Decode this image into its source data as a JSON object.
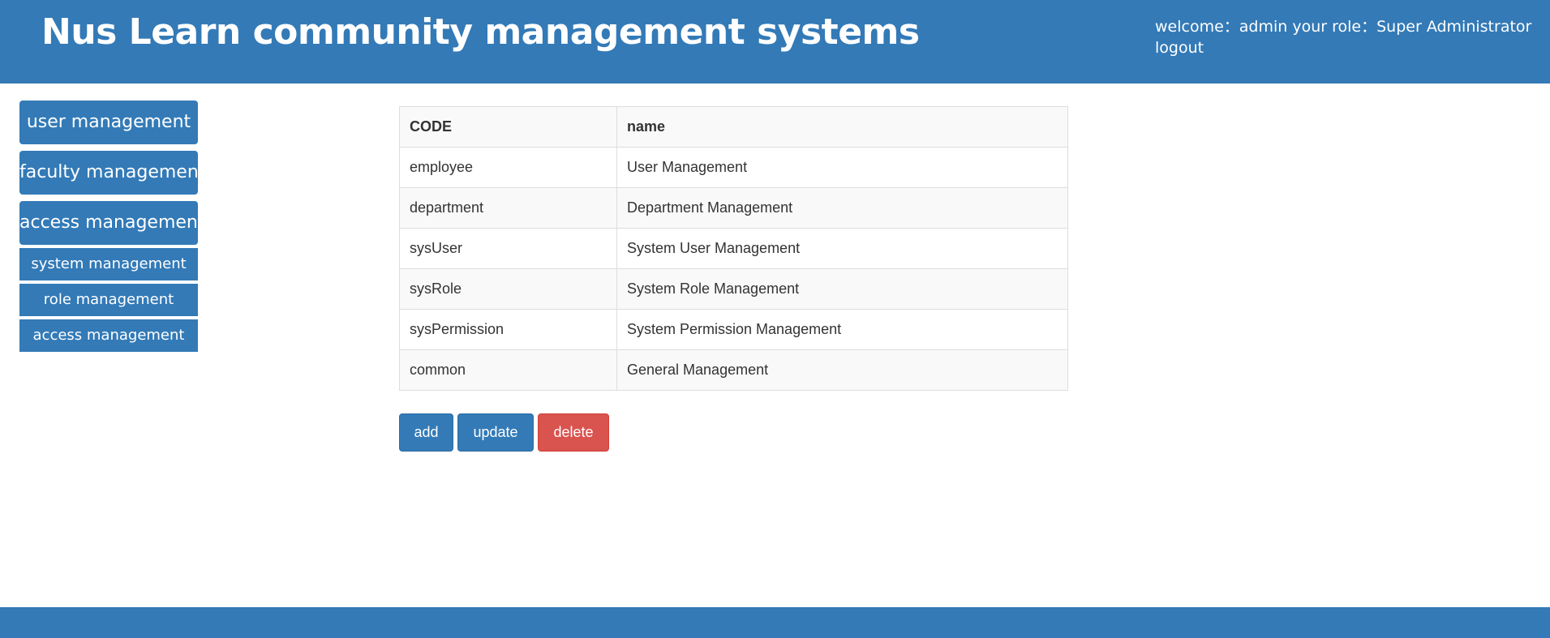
{
  "header": {
    "title": "Nus Learn community management systems",
    "welcome_label": "welcome：",
    "username": "admin",
    "role_label": "your role：",
    "role": "Super Administrator",
    "logout": "logout"
  },
  "sidebar": {
    "items": [
      {
        "label": "user management"
      },
      {
        "label": "faculty management"
      },
      {
        "label": "access management"
      }
    ],
    "subitems": [
      {
        "label": "system management"
      },
      {
        "label": "role management"
      },
      {
        "label": "access management"
      }
    ]
  },
  "table": {
    "columns": [
      "CODE",
      "name"
    ],
    "rows": [
      [
        "employee",
        "User Management"
      ],
      [
        "department",
        "Department Management"
      ],
      [
        "sysUser",
        "System User Management"
      ],
      [
        "sysRole",
        "System Role Management"
      ],
      [
        "sysPermission",
        "System Permission Management"
      ],
      [
        "common",
        "General Management"
      ]
    ]
  },
  "actions": {
    "add": "add",
    "update": "update",
    "delete": "delete"
  },
  "colors": {
    "primary": "#337ab7",
    "danger": "#d9534f",
    "stripe": "#f9f9f9",
    "border": "#dddddd"
  }
}
